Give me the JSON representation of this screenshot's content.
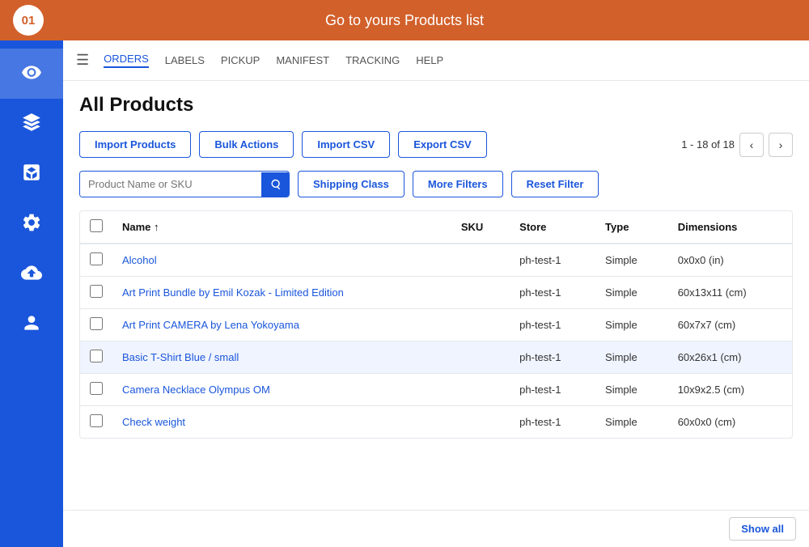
{
  "topBar": {
    "logo": "01",
    "title": "Go to yours Products list"
  },
  "sidebar": {
    "items": [
      {
        "name": "eye-icon",
        "label": "View"
      },
      {
        "name": "layers-icon",
        "label": "Layers"
      },
      {
        "name": "box-icon",
        "label": "Products"
      },
      {
        "name": "settings-icon",
        "label": "Settings"
      },
      {
        "name": "upload-icon",
        "label": "Upload"
      },
      {
        "name": "user-icon",
        "label": "User"
      }
    ]
  },
  "nav": {
    "links": [
      {
        "label": "ORDERS",
        "active": true
      },
      {
        "label": "LABELS",
        "active": false
      },
      {
        "label": "PICKUP",
        "active": false
      },
      {
        "label": "MANIFEST",
        "active": false
      },
      {
        "label": "TRACKING",
        "active": false
      },
      {
        "label": "HELP",
        "active": false
      }
    ]
  },
  "page": {
    "title": "All Products",
    "toolbar": {
      "import_products": "Import Products",
      "bulk_actions": "Bulk Actions",
      "import_csv": "Import CSV",
      "export_csv": "Export CSV",
      "pagination_info": "1 - 18 of 18"
    },
    "filters": {
      "search_placeholder": "Product Name or SKU",
      "shipping_class": "Shipping Class",
      "more_filters": "More Filters",
      "reset_filter": "Reset Filter"
    },
    "table": {
      "columns": [
        "",
        "Name ↑",
        "SKU",
        "Store",
        "Type",
        "Dimensions"
      ],
      "rows": [
        {
          "name": "Alcohol",
          "sku": "",
          "store": "ph-test-1",
          "type": "Simple",
          "dimensions": "0x0x0 (in)",
          "highlighted": false
        },
        {
          "name": "Art Print Bundle by Emil Kozak - Limited Edition",
          "sku": "",
          "store": "ph-test-1",
          "type": "Simple",
          "dimensions": "60x13x11 (cm)",
          "highlighted": false
        },
        {
          "name": "Art Print CAMERA by Lena Yokoyama",
          "sku": "",
          "store": "ph-test-1",
          "type": "Simple",
          "dimensions": "60x7x7 (cm)",
          "highlighted": false
        },
        {
          "name": "Basic T-Shirt Blue / small",
          "sku": "",
          "store": "ph-test-1",
          "type": "Simple",
          "dimensions": "60x26x1 (cm)",
          "highlighted": true
        },
        {
          "name": "Camera Necklace Olympus OM",
          "sku": "",
          "store": "ph-test-1",
          "type": "Simple",
          "dimensions": "10x9x2.5 (cm)",
          "highlighted": false
        },
        {
          "name": "Check weight",
          "sku": "",
          "store": "ph-test-1",
          "type": "Simple",
          "dimensions": "60x0x0 (cm)",
          "highlighted": false
        }
      ]
    },
    "bottom": {
      "show_all": "Show all"
    }
  }
}
